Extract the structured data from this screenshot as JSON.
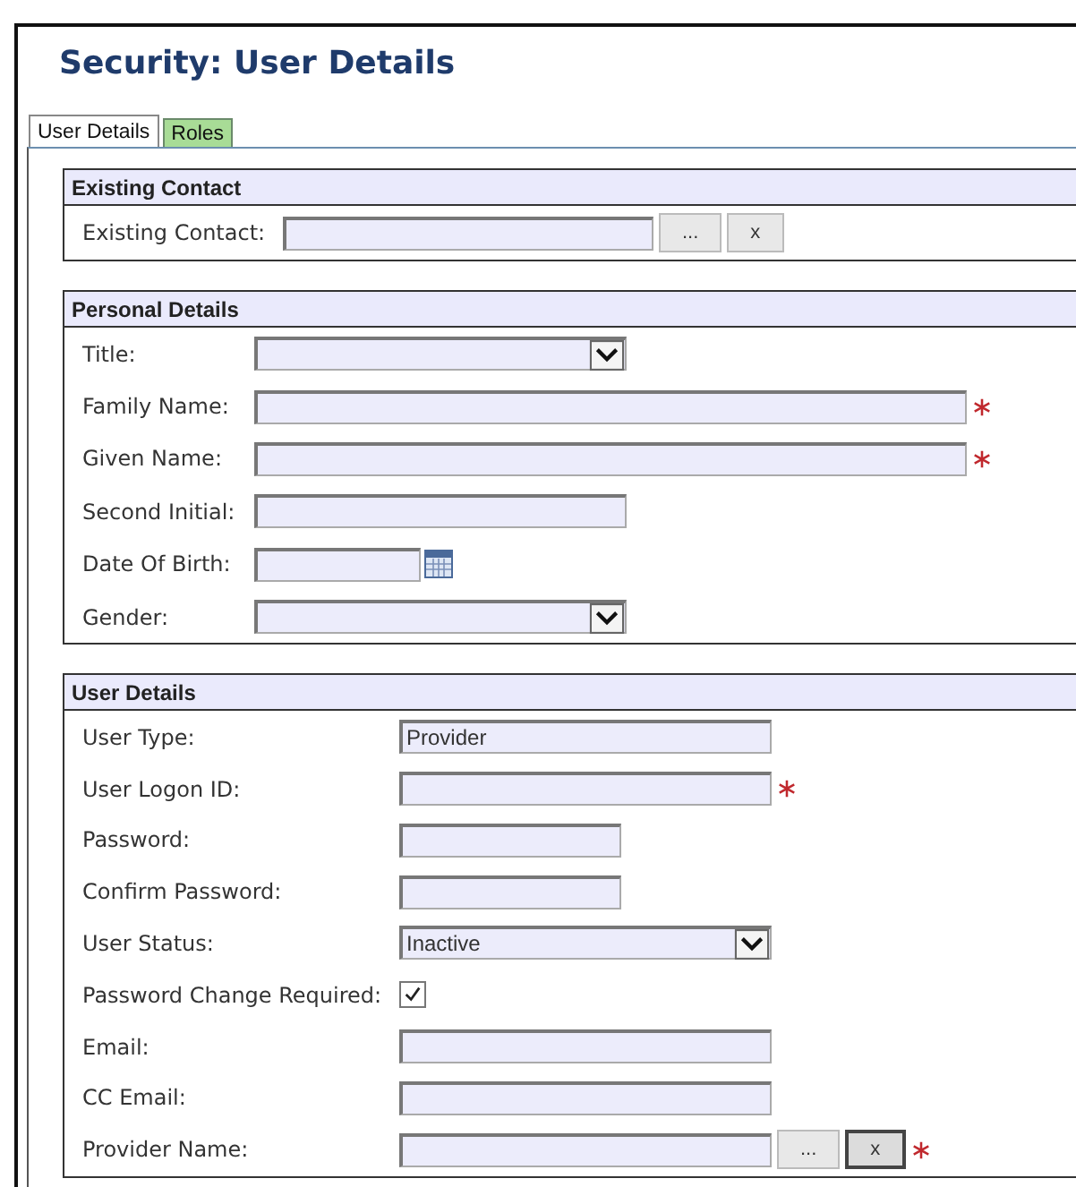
{
  "page": {
    "title": "Security: User Details"
  },
  "tabs": [
    {
      "label": "User Details",
      "selected": true
    },
    {
      "label": "Roles",
      "selected": false
    }
  ],
  "sections": [
    {
      "title": "Existing Contact",
      "fields": [
        {
          "label": "Existing Contact:",
          "kind": "lookup",
          "required": false,
          "buttons": [
            "...",
            "x"
          ]
        }
      ]
    },
    {
      "title": "Personal Details",
      "fields": [
        {
          "label": "Title:",
          "kind": "select",
          "required": false
        },
        {
          "label": "Family Name:",
          "kind": "text",
          "required": true
        },
        {
          "label": "Given Name:",
          "kind": "text",
          "required": true
        },
        {
          "label": "Second Initial:",
          "kind": "text",
          "required": false
        },
        {
          "label": "Date Of Birth:",
          "kind": "date",
          "required": false
        },
        {
          "label": "Gender:",
          "kind": "select",
          "required": false
        }
      ]
    },
    {
      "title": "User Details",
      "fields": [
        {
          "label": "User Type:",
          "kind": "text",
          "value": "Provider",
          "required": false
        },
        {
          "label": "User Logon ID:",
          "kind": "text",
          "required": true
        },
        {
          "label": "Password:",
          "kind": "text",
          "required": false
        },
        {
          "label": "Confirm Password:",
          "kind": "text",
          "required": false
        },
        {
          "label": "User Status:",
          "kind": "select",
          "value": "Inactive",
          "required": false
        },
        {
          "label": "Password Change Required:",
          "kind": "checkbox",
          "checked": true
        },
        {
          "label": "Email:",
          "kind": "text",
          "required": false
        },
        {
          "label": "CC Email:",
          "kind": "text",
          "required": false
        },
        {
          "label": "Provider Name:",
          "kind": "lookup",
          "required": true,
          "buttons": [
            "...",
            "x"
          ]
        }
      ]
    }
  ]
}
